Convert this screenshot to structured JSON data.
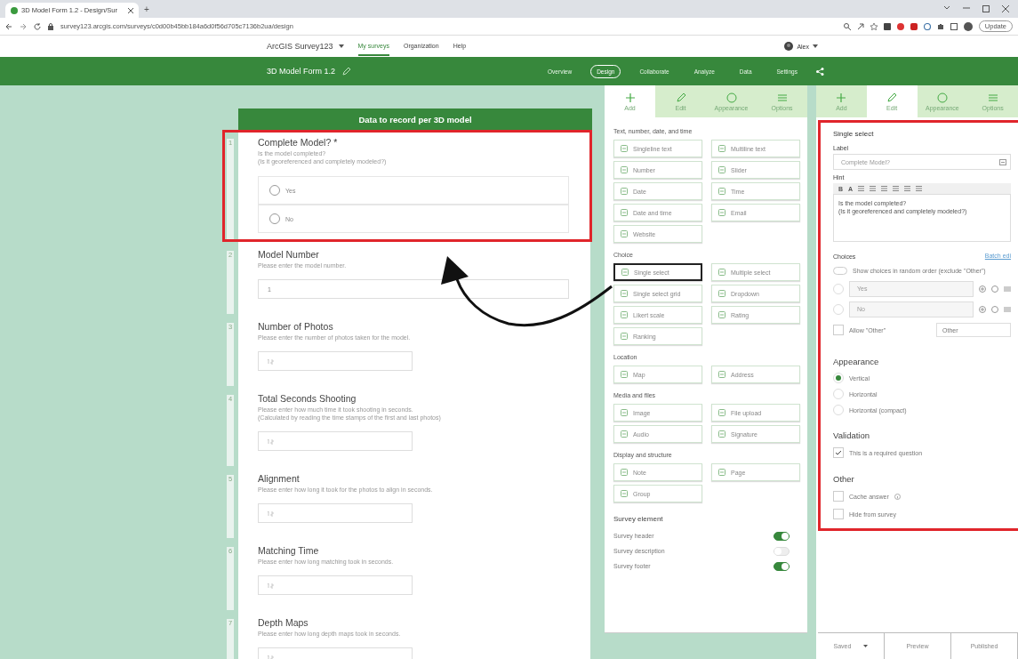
{
  "browser": {
    "tab_title": "3D Model Form 1.2 - Design/Sur",
    "new_tab": "+",
    "url": "survey123.arcgis.com/surveys/c0d00b45bb184a6d0f56d705c7136b2ua/design",
    "update_button": "Update"
  },
  "app_header": {
    "product": "ArcGIS Survey123",
    "nav": [
      {
        "label": "My surveys",
        "selected": true
      },
      {
        "label": "Organization",
        "selected": false
      },
      {
        "label": "Help",
        "selected": false
      }
    ],
    "user": "Alex"
  },
  "survey_bar": {
    "title": "3D Model Form 1.2",
    "tabs": [
      {
        "label": "Overview",
        "selected": false
      },
      {
        "label": "Design",
        "selected": true
      },
      {
        "label": "Collaborate",
        "selected": false
      },
      {
        "label": "Analyze",
        "selected": false
      },
      {
        "label": "Data",
        "selected": false
      },
      {
        "label": "Settings",
        "selected": false
      }
    ]
  },
  "form": {
    "header": "Data to record per 3D model",
    "questions": [
      {
        "number": "1",
        "kind": "choice",
        "label": "Complete Model? *",
        "hint": [
          "Is the model completed?",
          "(Is it georeferenced and completely modeled?)"
        ],
        "choices": [
          "Yes",
          "No"
        ],
        "highlighted": true
      },
      {
        "number": "2",
        "kind": "text",
        "label": "Model Number",
        "hint": [
          "Please enter the model number."
        ],
        "value": "1",
        "highlighted": false
      },
      {
        "number": "3",
        "kind": "number",
        "label": "Number of Photos",
        "hint": [
          "Please enter the number of photos taken for the model."
        ],
        "highlighted": false
      },
      {
        "number": "4",
        "kind": "number",
        "label": "Total Seconds Shooting",
        "hint": [
          "Please enter how much time it took shooting in seconds.",
          "(Calculated by reading the time stamps of the first and last photos)"
        ],
        "highlighted": false
      },
      {
        "number": "5",
        "kind": "number",
        "label": "Alignment",
        "hint": [
          "Please enter how long it took for the photos to align in seconds."
        ],
        "highlighted": false
      },
      {
        "number": "6",
        "kind": "number",
        "label": "Matching Time",
        "hint": [
          "Please enter how long matching took in seconds."
        ],
        "highlighted": false
      },
      {
        "number": "7",
        "kind": "number",
        "label": "Depth Maps",
        "hint": [
          "Please enter how long depth maps took in seconds."
        ],
        "highlighted": false
      }
    ]
  },
  "add_panel": {
    "tabs": [
      {
        "label": "Add",
        "selected": true
      },
      {
        "label": "Edit",
        "selected": false
      },
      {
        "label": "Appearance",
        "selected": false
      },
      {
        "label": "Options",
        "selected": false
      }
    ],
    "sections": [
      {
        "title": "Text, number, date, and time",
        "items": [
          {
            "label": "Singleline text",
            "highlighted": false
          },
          {
            "label": "Multiline text",
            "highlighted": false
          },
          {
            "label": "Number",
            "highlighted": false
          },
          {
            "label": "Slider",
            "highlighted": false
          },
          {
            "label": "Date",
            "highlighted": false
          },
          {
            "label": "Time",
            "highlighted": false
          },
          {
            "label": "Date and time",
            "highlighted": false
          },
          {
            "label": "Email",
            "highlighted": false
          },
          {
            "label": "Website",
            "highlighted": false
          }
        ]
      },
      {
        "title": "Choice",
        "items": [
          {
            "label": "Single select",
            "highlighted": true
          },
          {
            "label": "Multiple select",
            "highlighted": false
          },
          {
            "label": "Single select grid",
            "highlighted": false
          },
          {
            "label": "Dropdown",
            "highlighted": false
          },
          {
            "label": "Likert scale",
            "highlighted": false
          },
          {
            "label": "Rating",
            "highlighted": false
          },
          {
            "label": "Ranking",
            "highlighted": false
          }
        ]
      },
      {
        "title": "Location",
        "items": [
          {
            "label": "Map",
            "highlighted": false
          },
          {
            "label": "Address",
            "highlighted": false
          }
        ]
      },
      {
        "title": "Media and files",
        "items": [
          {
            "label": "Image",
            "highlighted": false
          },
          {
            "label": "File upload",
            "highlighted": false
          },
          {
            "label": "Audio",
            "highlighted": false
          },
          {
            "label": "Signature",
            "highlighted": false
          }
        ]
      },
      {
        "title": "Display and structure",
        "items": [
          {
            "label": "Note",
            "highlighted": false
          },
          {
            "label": "Page",
            "highlighted": false
          },
          {
            "label": "Group",
            "highlighted": false
          }
        ]
      }
    ],
    "survey_element": {
      "title": "Survey element",
      "toggles": [
        {
          "label": "Survey header",
          "on": true
        },
        {
          "label": "Survey description",
          "on": false
        },
        {
          "label": "Survey footer",
          "on": true
        }
      ]
    }
  },
  "edit_panel": {
    "tabs": [
      {
        "label": "Add",
        "selected": false
      },
      {
        "label": "Edit",
        "selected": true
      },
      {
        "label": "Appearance",
        "selected": false
      },
      {
        "label": "Options",
        "selected": false
      }
    ],
    "highlighted": true,
    "type_title": "Single select",
    "label_caption": "Label",
    "label_value": "Complete Model?",
    "hint_caption": "Hint",
    "toolbar": [
      "B",
      "A"
    ],
    "hint_lines": [
      "Is the model completed?",
      "(Is it georeferenced and completely modeled?)"
    ],
    "choices_caption": "Choices",
    "batch_edit": "Batch edi",
    "random_order": {
      "label": "Show choices in random order (exclude \"Other\")",
      "on": false
    },
    "choices": [
      {
        "label": "Yes"
      },
      {
        "label": "No"
      }
    ],
    "allow_other": {
      "label": "Allow \"Other\"",
      "checked": false,
      "placeholder": "Other"
    },
    "appearance": {
      "title": "Appearance",
      "options": [
        {
          "label": "Vertical",
          "selected": true
        },
        {
          "label": "Horizontal",
          "selected": false
        },
        {
          "label": "Horizontal (compact)",
          "selected": false
        }
      ]
    },
    "validation": {
      "title": "Validation",
      "options": [
        {
          "label": "This is a required question",
          "checked": true,
          "info": false
        }
      ]
    },
    "other": {
      "title": "Other",
      "options": [
        {
          "label": "Cache answer",
          "checked": false,
          "info": true
        },
        {
          "label": "Hide from survey",
          "checked": false,
          "info": false
        }
      ]
    }
  },
  "footer": {
    "buttons": [
      {
        "label": "Saved",
        "kind": "menu"
      },
      {
        "label": "Preview",
        "kind": "plain"
      },
      {
        "label": "Published",
        "kind": "plain"
      }
    ]
  }
}
